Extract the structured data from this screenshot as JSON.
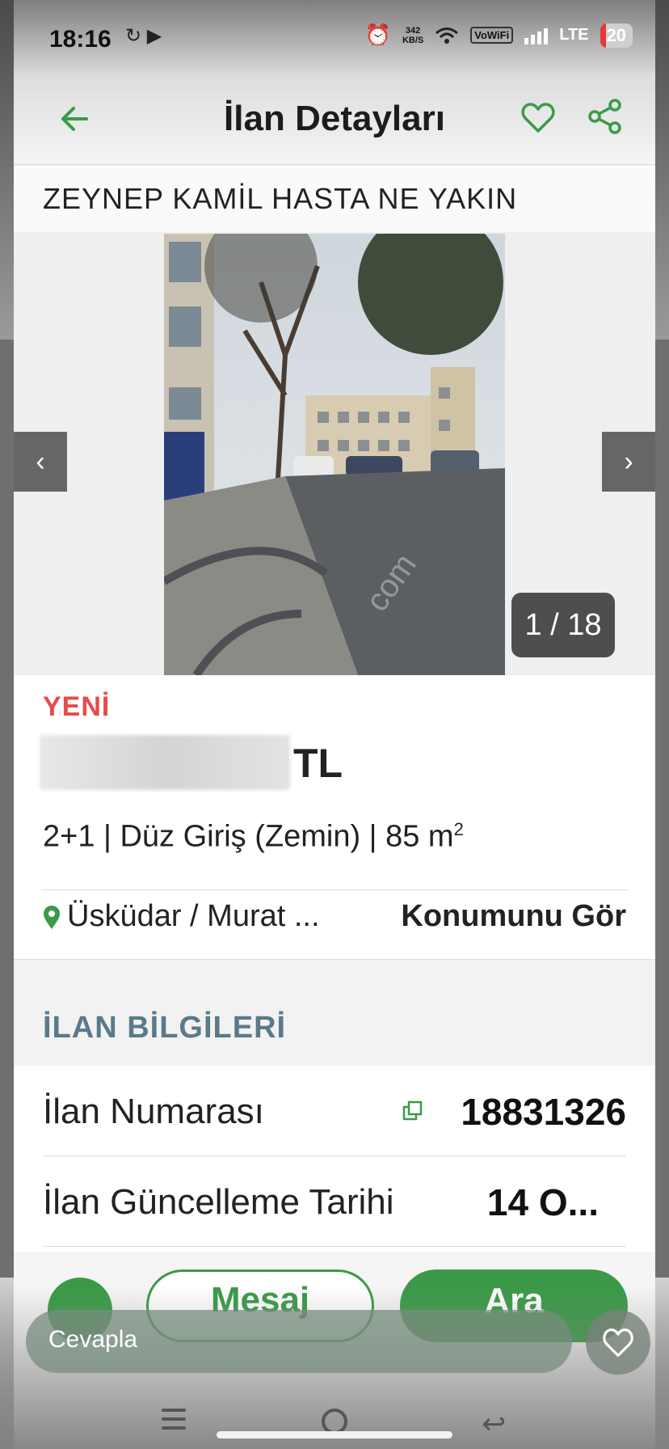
{
  "status_bar": {
    "time": "18:16",
    "net_speed_value": "342",
    "net_speed_unit": "KB/S",
    "vowifi": "VoWiFi",
    "network": "LTE",
    "battery": "20"
  },
  "header": {
    "title": "İlan Detayları"
  },
  "listing": {
    "title": "ZEYNEP KAMİL HASTA NE YAKIN",
    "photo_counter": "1 / 18",
    "badge": "YENİ",
    "currency": "TL",
    "specs": "2+1 | Düz Giriş (Zemin) | 85 m",
    "specs_sup": "2",
    "location": "Üsküdar / Murat ...",
    "location_link": "Konumunu Gör"
  },
  "section": {
    "title": "İLAN BİLGİLERİ"
  },
  "details": [
    {
      "label": "İlan Numarası",
      "value": "18831326"
    },
    {
      "label": "İlan Güncelleme Tarihi",
      "value": "14 O..."
    }
  ],
  "actions": {
    "message": "Mesaj",
    "call": "Ara"
  },
  "overlay": {
    "reply_placeholder": "Cevapla"
  },
  "colors": {
    "brand_green": "#3a9a48",
    "badge_red": "#e84b4b",
    "section_blue_gray": "#5a7a8a"
  }
}
